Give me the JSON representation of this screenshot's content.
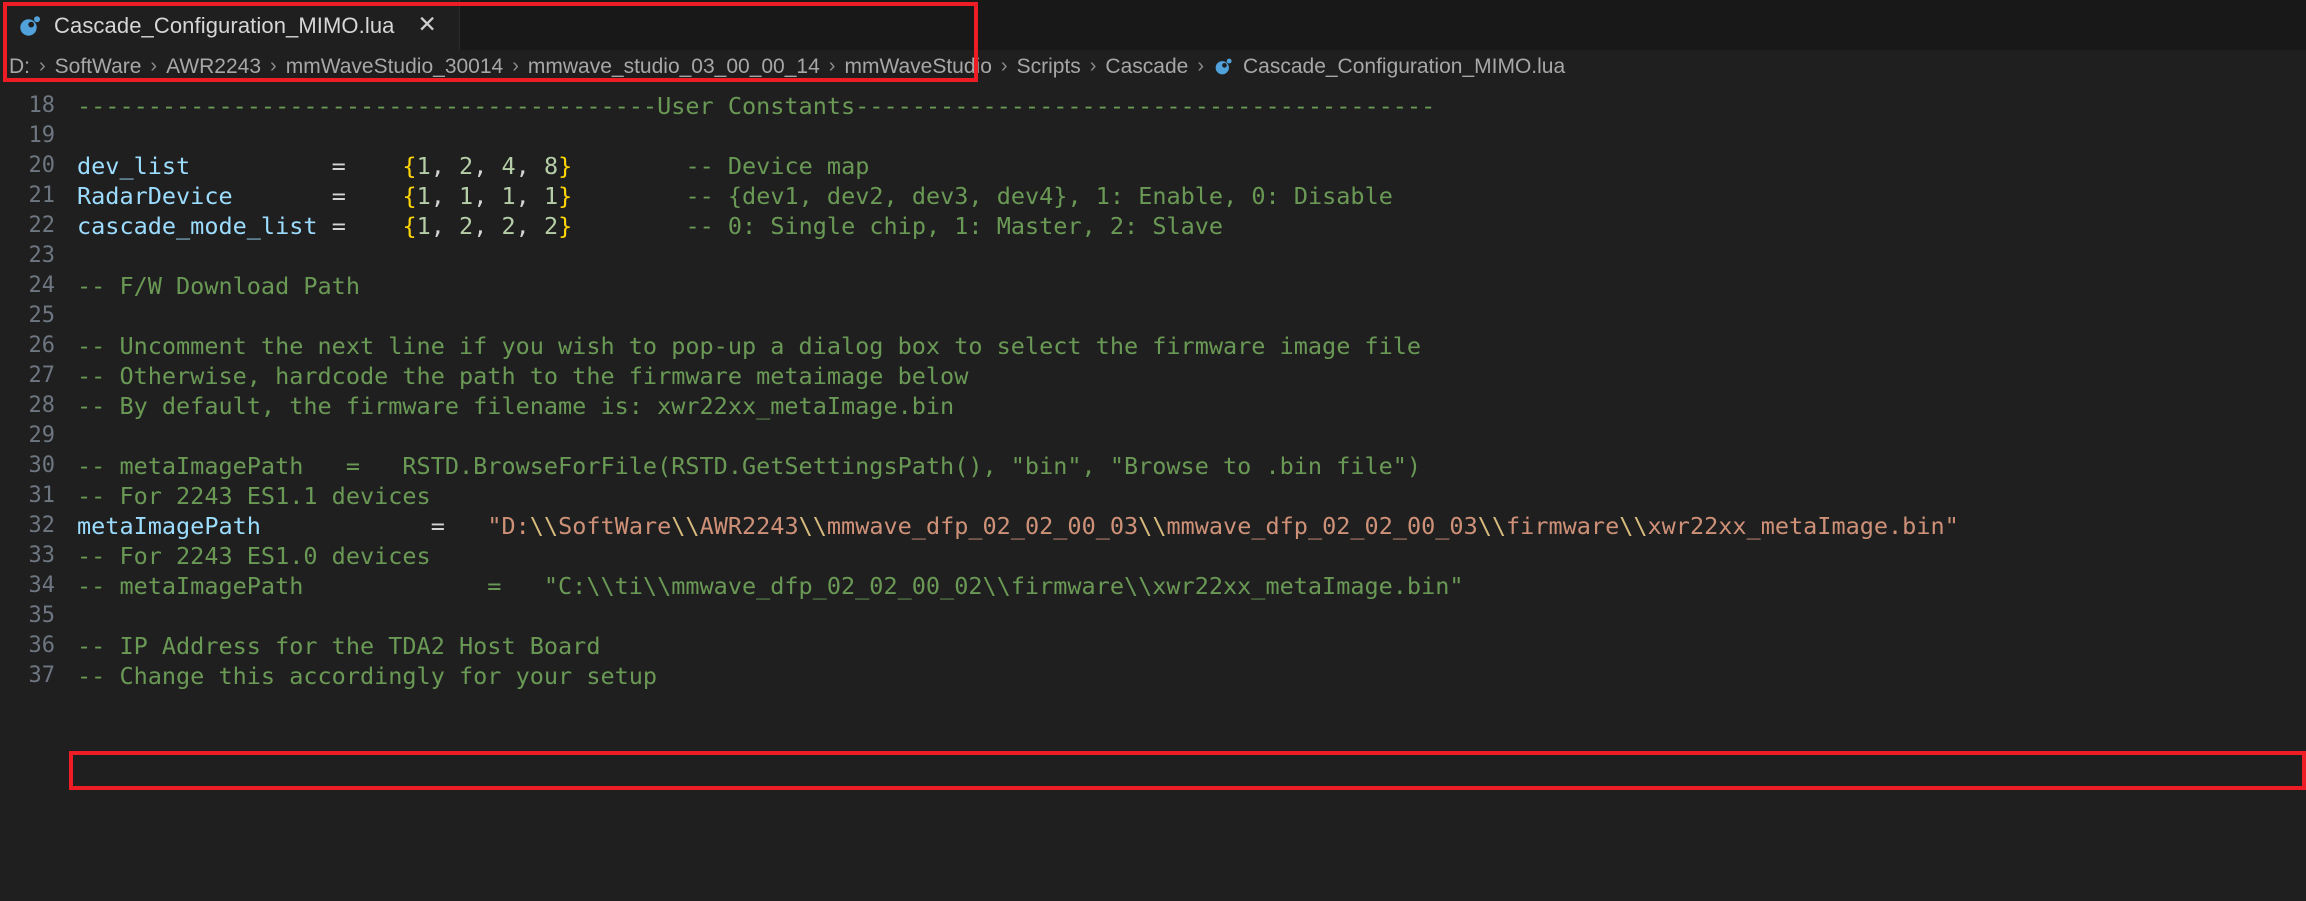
{
  "window": {
    "background_color": "#1f1f1f",
    "annotation_color": "#ee1c25"
  },
  "tabbar": {
    "tabs": [
      {
        "label": "Cascade_Configuration_MIMO.lua",
        "icon": "lua-moon-icon",
        "close_label": "✕",
        "active": true
      }
    ]
  },
  "breadcrumb": {
    "segments": [
      "D:",
      "SoftWare",
      "AWR2243",
      "mmWaveStudio_30014",
      "mmwave_studio_03_00_00_14",
      "mmWaveStudio",
      "Scripts",
      "Cascade"
    ],
    "separator": "›",
    "file": "Cascade_Configuration_MIMO.lua",
    "file_icon": "lua-moon-icon"
  },
  "editor": {
    "language": "lua",
    "first_visible_line": 18,
    "highlighted_line": 32,
    "lines": [
      {
        "number": 18,
        "tokens": [
          {
            "t": "-----------------------------------------User Constants-----------------------------------------",
            "c": "t-com"
          }
        ]
      },
      {
        "number": 19,
        "tokens": []
      },
      {
        "number": 20,
        "tokens": [
          {
            "t": "dev_list",
            "c": "t-var"
          },
          {
            "t": "          ",
            "c": "t-plain"
          },
          {
            "t": "=",
            "c": "t-op"
          },
          {
            "t": "    ",
            "c": "t-plain"
          },
          {
            "t": "{",
            "c": "t-brc"
          },
          {
            "t": "1",
            "c": "t-num"
          },
          {
            "t": ", ",
            "c": "t-plain"
          },
          {
            "t": "2",
            "c": "t-num"
          },
          {
            "t": ", ",
            "c": "t-plain"
          },
          {
            "t": "4",
            "c": "t-num"
          },
          {
            "t": ", ",
            "c": "t-plain"
          },
          {
            "t": "8",
            "c": "t-num"
          },
          {
            "t": "}",
            "c": "t-brc"
          },
          {
            "t": "        ",
            "c": "t-plain"
          },
          {
            "t": "-- Device map",
            "c": "t-com"
          }
        ]
      },
      {
        "number": 21,
        "tokens": [
          {
            "t": "RadarDevice",
            "c": "t-var"
          },
          {
            "t": "       ",
            "c": "t-plain"
          },
          {
            "t": "=",
            "c": "t-op"
          },
          {
            "t": "    ",
            "c": "t-plain"
          },
          {
            "t": "{",
            "c": "t-brc"
          },
          {
            "t": "1",
            "c": "t-num"
          },
          {
            "t": ", ",
            "c": "t-plain"
          },
          {
            "t": "1",
            "c": "t-num"
          },
          {
            "t": ", ",
            "c": "t-plain"
          },
          {
            "t": "1",
            "c": "t-num"
          },
          {
            "t": ", ",
            "c": "t-plain"
          },
          {
            "t": "1",
            "c": "t-num"
          },
          {
            "t": "}",
            "c": "t-brc"
          },
          {
            "t": "        ",
            "c": "t-plain"
          },
          {
            "t": "-- {dev1, dev2, dev3, dev4}, 1: Enable, 0: Disable",
            "c": "t-com"
          }
        ]
      },
      {
        "number": 22,
        "tokens": [
          {
            "t": "cascade_mode_list",
            "c": "t-var"
          },
          {
            "t": " ",
            "c": "t-plain"
          },
          {
            "t": "=",
            "c": "t-op"
          },
          {
            "t": "    ",
            "c": "t-plain"
          },
          {
            "t": "{",
            "c": "t-brc"
          },
          {
            "t": "1",
            "c": "t-num"
          },
          {
            "t": ", ",
            "c": "t-plain"
          },
          {
            "t": "2",
            "c": "t-num"
          },
          {
            "t": ", ",
            "c": "t-plain"
          },
          {
            "t": "2",
            "c": "t-num"
          },
          {
            "t": ", ",
            "c": "t-plain"
          },
          {
            "t": "2",
            "c": "t-num"
          },
          {
            "t": "}",
            "c": "t-brc"
          },
          {
            "t": "        ",
            "c": "t-plain"
          },
          {
            "t": "-- 0: Single chip, 1: Master, 2: Slave",
            "c": "t-com"
          }
        ]
      },
      {
        "number": 23,
        "tokens": []
      },
      {
        "number": 24,
        "tokens": [
          {
            "t": "-- F/W Download Path",
            "c": "t-com"
          }
        ]
      },
      {
        "number": 25,
        "tokens": []
      },
      {
        "number": 26,
        "tokens": [
          {
            "t": "-- Uncomment the next line if you wish to pop-up a dialog box to select the firmware image file",
            "c": "t-com"
          }
        ]
      },
      {
        "number": 27,
        "tokens": [
          {
            "t": "-- Otherwise, hardcode the path to the firmware metaimage below",
            "c": "t-com"
          }
        ]
      },
      {
        "number": 28,
        "tokens": [
          {
            "t": "-- By default, the firmware filename is: xwr22xx_metaImage.bin",
            "c": "t-com"
          }
        ]
      },
      {
        "number": 29,
        "tokens": []
      },
      {
        "number": 30,
        "tokens": [
          {
            "t": "-- metaImagePath   =   RSTD.BrowseForFile(RSTD.GetSettingsPath(), \"bin\", \"Browse to .bin file\")",
            "c": "t-com"
          }
        ]
      },
      {
        "number": 31,
        "tokens": [
          {
            "t": "-- For 2243 ES1.1 devices",
            "c": "t-com"
          }
        ]
      },
      {
        "number": 32,
        "tokens": [
          {
            "t": "metaImagePath",
            "c": "t-var"
          },
          {
            "t": "            ",
            "c": "t-plain"
          },
          {
            "t": "=",
            "c": "t-op"
          },
          {
            "t": "   ",
            "c": "t-plain"
          },
          {
            "t": "\"D:",
            "c": "t-str"
          },
          {
            "t": "\\\\",
            "c": "t-esc"
          },
          {
            "t": "SoftWare",
            "c": "t-str"
          },
          {
            "t": "\\\\",
            "c": "t-esc"
          },
          {
            "t": "AWR2243",
            "c": "t-str"
          },
          {
            "t": "\\\\",
            "c": "t-esc"
          },
          {
            "t": "mmwave_dfp_02_02_00_03",
            "c": "t-str"
          },
          {
            "t": "\\\\",
            "c": "t-esc"
          },
          {
            "t": "mmwave_dfp_02_02_00_03",
            "c": "t-str"
          },
          {
            "t": "\\\\",
            "c": "t-esc"
          },
          {
            "t": "firmware",
            "c": "t-str"
          },
          {
            "t": "\\\\",
            "c": "t-esc"
          },
          {
            "t": "xwr22xx_metaImage.bin\"",
            "c": "t-str"
          }
        ]
      },
      {
        "number": 33,
        "tokens": [
          {
            "t": "-- For 2243 ES1.0 devices",
            "c": "t-com"
          }
        ]
      },
      {
        "number": 34,
        "tokens": [
          {
            "t": "-- metaImagePath             =   \"C:\\\\ti\\\\mmwave_dfp_02_02_00_02\\\\firmware\\\\xwr22xx_metaImage.bin\"",
            "c": "t-com"
          }
        ]
      },
      {
        "number": 35,
        "tokens": []
      },
      {
        "number": 36,
        "tokens": [
          {
            "t": "-- IP Address for the TDA2 Host Board",
            "c": "t-com"
          }
        ]
      },
      {
        "number": 37,
        "tokens": [
          {
            "t": "-- Change this accordingly for your setup",
            "c": "t-com"
          }
        ]
      }
    ]
  }
}
